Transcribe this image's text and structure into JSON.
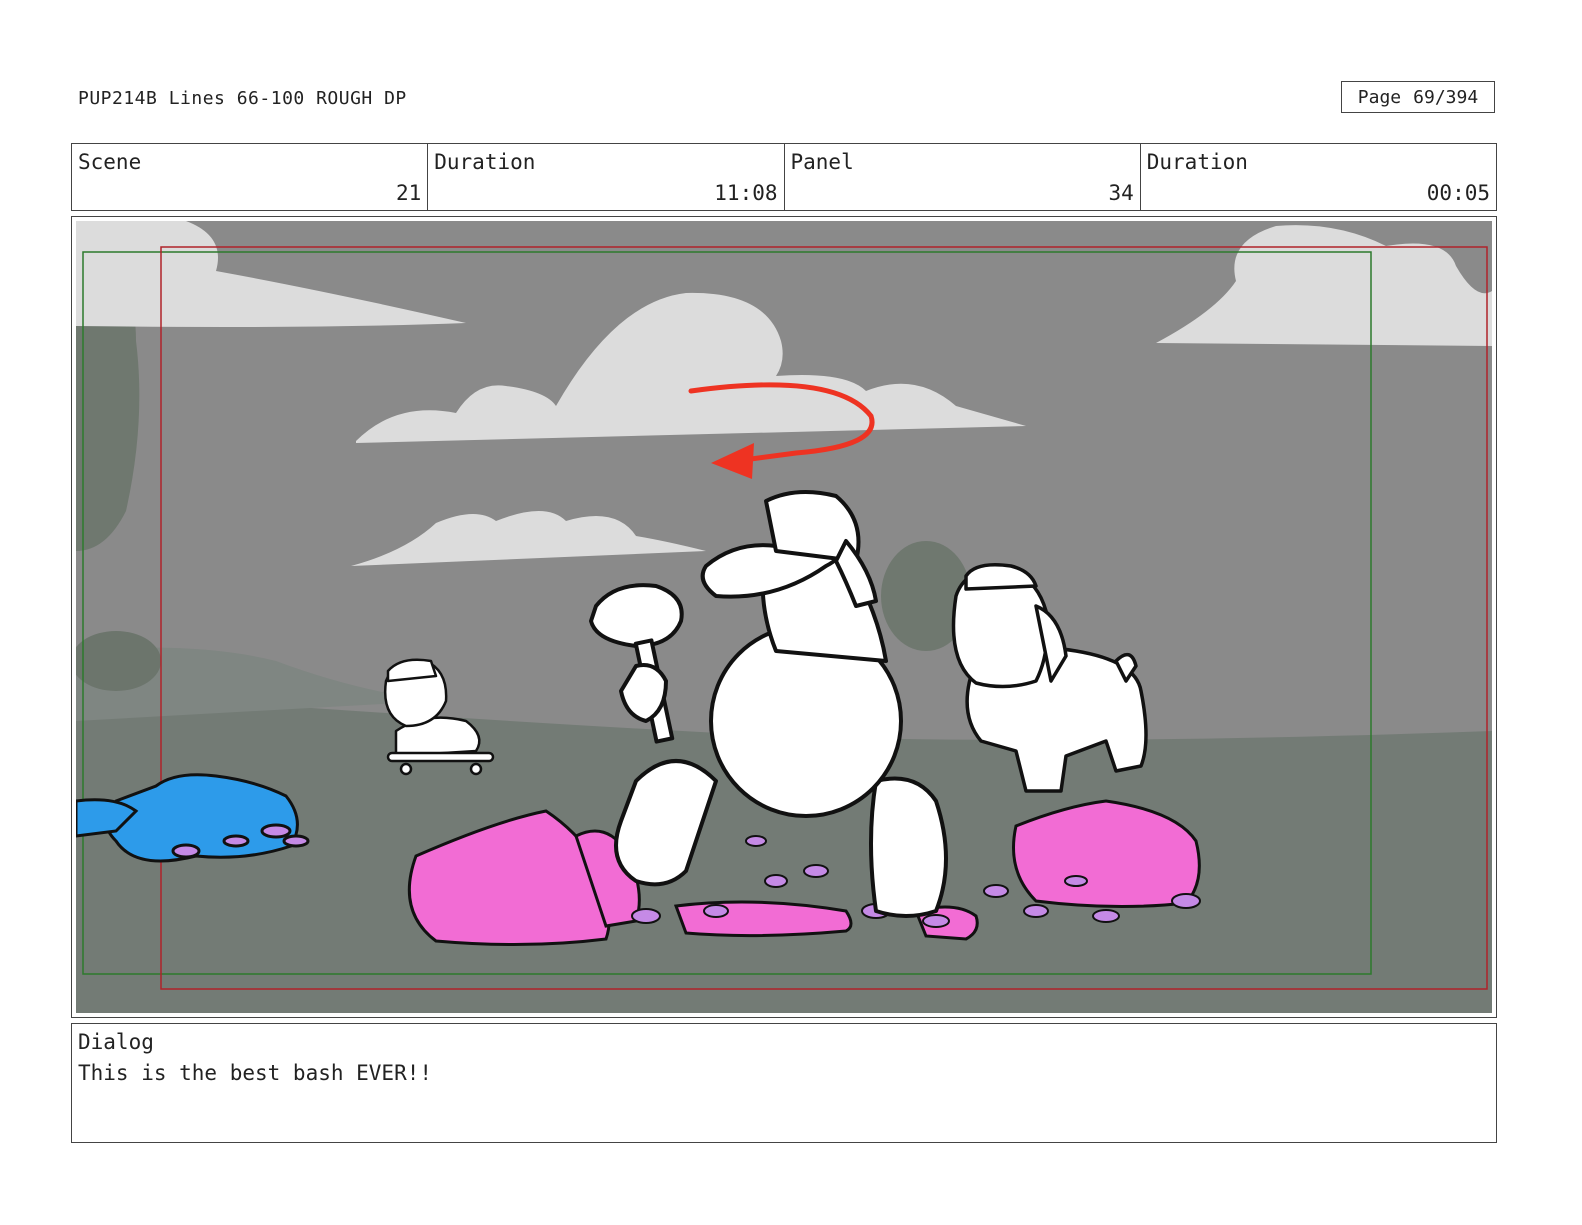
{
  "header": {
    "title": "PUP214B Lines 66-100 ROUGH DP",
    "page_label": "Page",
    "page_value": "69/394"
  },
  "info": {
    "scene_label": "Scene",
    "scene_value": "21",
    "scene_duration_label": "Duration",
    "scene_duration_value": "11:08",
    "panel_label": "Panel",
    "panel_value": "34",
    "panel_duration_label": "Duration",
    "panel_duration_value": "00:05"
  },
  "dialog": {
    "label": "Dialog",
    "text": "This is the best bash EVER!!"
  },
  "colors": {
    "sky": "#8a8a8a",
    "cloud": "#dcdcdc",
    "ground": "#727a74",
    "rock_pink": "#f26cd4",
    "rock_blue": "#2d9bea",
    "pebble": "#c58ae6",
    "arrow_red": "#ee3322",
    "safe_red": "#b0232a",
    "safe_green": "#2d7a2d"
  },
  "panel_art": {
    "scene_description_icons": [
      "cloud-icon",
      "rock-pile-icon",
      "camera-arrow-icon",
      "pup-with-hammer-icon",
      "pup-sitting-icon",
      "pup-skateboard-icon"
    ]
  }
}
